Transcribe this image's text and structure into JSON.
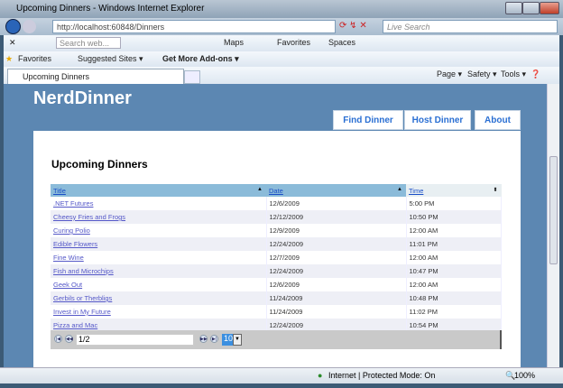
{
  "window": {
    "title": "Upcoming Dinners - Windows Internet Explorer"
  },
  "address": {
    "url": "http://localhost:60848/Dinners",
    "search_placeholder": "Live Search"
  },
  "toolbar": {
    "search_placeholder": "Search web...",
    "maps": "Maps",
    "favorites": "Favorites",
    "spaces": "Spaces"
  },
  "favbar": {
    "favorites": "Favorites",
    "suggested": "Suggested Sites ▾",
    "addons": "Get More Add-ons ▾"
  },
  "tab": {
    "label": "Upcoming Dinners"
  },
  "commandbar": {
    "page": "Page ▾",
    "safety": "Safety ▾",
    "tools": "Tools ▾"
  },
  "site": {
    "logo": "NerdDinner",
    "nav": [
      "Find Dinner",
      "Host Dinner",
      "About"
    ],
    "heading": "Upcoming Dinners"
  },
  "grid": {
    "columns": [
      "Title",
      "Date",
      "Time"
    ],
    "rows": [
      [
        ".NET Futures",
        "12/6/2009",
        "5:00 PM"
      ],
      [
        "Cheesy Fries and Frogs",
        "12/12/2009",
        "10:50 PM"
      ],
      [
        "Curing Polio",
        "12/9/2009",
        "12:00 AM"
      ],
      [
        "Edible Flowers",
        "12/24/2009",
        "11:01 PM"
      ],
      [
        "Fine Wine",
        "12/7/2009",
        "12:00 AM"
      ],
      [
        "Fish and Microchips",
        "12/24/2009",
        "10:47 PM"
      ],
      [
        "Geek Out",
        "12/6/2009",
        "12:00 AM"
      ],
      [
        "Gerbils or Therbligs",
        "11/24/2009",
        "10:48 PM"
      ],
      [
        "Invest in My Future",
        "11/24/2009",
        "11:02 PM"
      ],
      [
        "Pizza and Mac",
        "12/24/2009",
        "10:54 PM"
      ]
    ],
    "pager": {
      "page": "1/2",
      "page_size": "10"
    }
  },
  "status": {
    "zone": "Internet | Protected Mode: On",
    "zoom": "100%"
  }
}
